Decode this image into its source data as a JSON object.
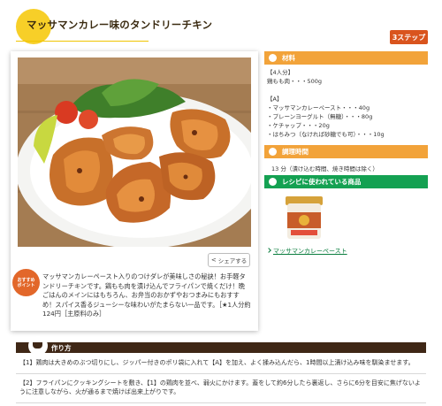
{
  "header": {
    "title": "マッサマンカレー味のタンドリーチキン",
    "steps_badge": "3ステップ"
  },
  "share": {
    "label": "シェアする"
  },
  "recommend": {
    "line1": "おすすめ",
    "line2": "ポイント"
  },
  "description": "マッサマンカレーペースト入りのつけダレが美味しさの秘訣！お手軽タンドリーチキンです。鶏もも肉を漬け込んでフライパンで焼くだけ！晩ごはんのメインにはもちろん、お弁当のおかずやおつまみにもおすすめ！スパイス香るジューシーな味わいがたまらない一品です。［★1人分約124円［主原料のみ］",
  "materials": {
    "heading": "材料",
    "servings": "【4人分】",
    "main": "鶏もも肉・・・500g",
    "group_a_label": "【A】",
    "items": [
      "・マッサマンカレーペースト・・・40g",
      "・プレーンヨーグルト（無糖）・・・80g",
      "・ケチャップ・・・20g",
      "・はちみつ（なければ砂糖でも可）・・・10g"
    ]
  },
  "cooking_time": {
    "heading": "調理時間",
    "value": "13 分（漬け込む時間、焼き時間は除く）"
  },
  "products": {
    "heading": "レシピに使われている商品",
    "link": "マッサマンカレーペースト"
  },
  "method": {
    "heading": "作り方",
    "steps": [
      "【1】鶏肉は大きめのぶつ切りにし、ジッパー付きのポリ袋に入れて【A】を加え、よく揉み込んだら、1時間以上漬け込み味を馴染ませます。",
      "【2】フライパンにクッキングシートを敷き、【1】の鶏肉を並べ、弱火にかけます。蓋をして約6分したら裏返し、さらに6分を目安に焦げないように注意しながら、火が通るまで焼けば出来上がりです。"
    ]
  },
  "colors": {
    "steps_badge": "#d9541e",
    "materials_header": "#f2a33a",
    "products_header": "#14a152",
    "method_bar": "#3f2716",
    "title_circle": "#f7cf28"
  }
}
